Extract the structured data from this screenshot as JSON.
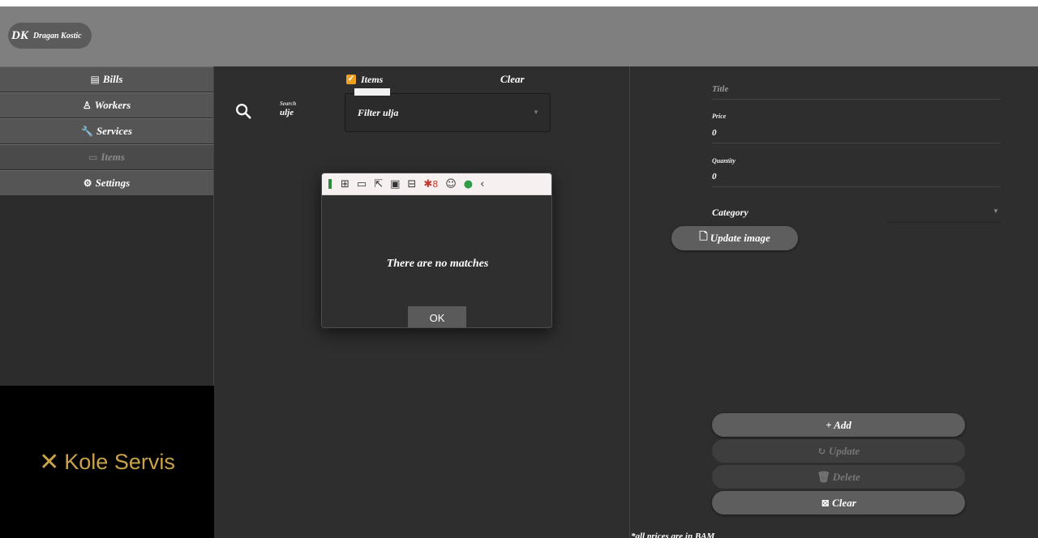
{
  "user": {
    "initials": "DK",
    "name": "Dragan Kostic"
  },
  "sidebar": {
    "items": [
      {
        "label": "Bills",
        "icon": "receipt-icon",
        "glyph": "▤"
      },
      {
        "label": "Workers",
        "icon": "worker-icon",
        "glyph": "♙"
      },
      {
        "label": "Services",
        "icon": "wrench-icon",
        "glyph": "🔧"
      },
      {
        "label": "Items",
        "icon": "items-icon",
        "glyph": "▭"
      },
      {
        "label": "Settings",
        "icon": "gear-icon",
        "glyph": "⚙"
      }
    ],
    "active_index": 3,
    "logo_text": "Kole Servis"
  },
  "search": {
    "label": "Search",
    "value": "ulje"
  },
  "filter": {
    "checkbox_label": "Items",
    "checked": true,
    "clear_label": "Clear",
    "select_value": "Filter ulja"
  },
  "form": {
    "title_placeholder": "Title",
    "price_label": "Price",
    "price_value": "0",
    "quantity_label": "Quantity",
    "quantity_value": "0",
    "category_label": "Category",
    "update_image_label": "Update image",
    "add_label": "+ Add",
    "update_label": "Update",
    "delete_label": "Delete",
    "clear_label": "Clear",
    "footnote": "*all prices are in BAM"
  },
  "dialog": {
    "message": "There are no matches",
    "ok_label": "OK",
    "toolbar_count": "8"
  },
  "colors": {
    "accent": "#f0a020",
    "logo": "#c9a24a",
    "topbar": "#7f7f7f",
    "panel": "#2e2e2e",
    "button": "#5e5e5e"
  }
}
